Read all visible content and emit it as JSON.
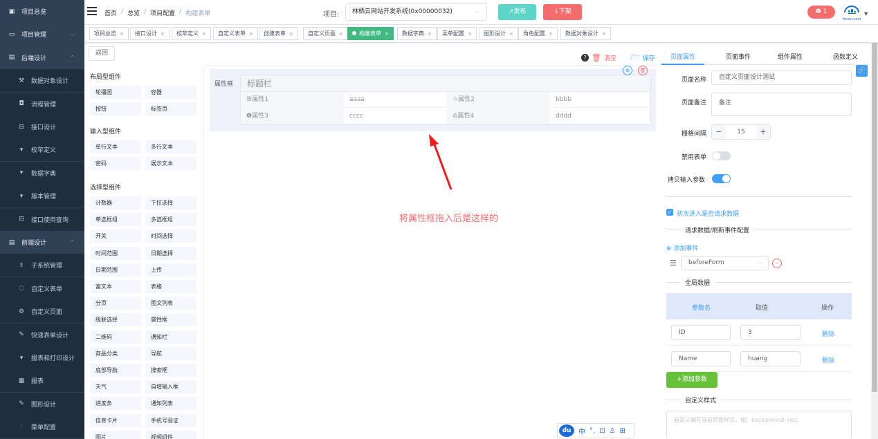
{
  "sidebar": {
    "items": [
      {
        "label": "项目总览",
        "icon": "folder-icon",
        "type": "top",
        "chevron": ""
      },
      {
        "label": "项目管理",
        "icon": "monitor-icon",
        "type": "top",
        "chevron": "⌵"
      },
      {
        "label": "后端设计",
        "icon": "server-icon",
        "type": "top",
        "chevron": "⌃"
      },
      {
        "label": "数据对象设计",
        "icon": "wrench-icon",
        "type": "sub",
        "chevron": ""
      },
      {
        "label": "流程管理",
        "icon": "flow-icon",
        "type": "sub",
        "chevron": ""
      },
      {
        "label": "接口设计",
        "icon": "api-icon",
        "type": "sub",
        "chevron": ""
      },
      {
        "label": "校苹定义",
        "icon": "cup-icon",
        "type": "sub",
        "chevron": ""
      },
      {
        "label": "数据字典",
        "icon": "cup-icon",
        "type": "sub",
        "chevron": ""
      },
      {
        "label": "版本管理",
        "icon": "cup-icon",
        "type": "sub",
        "chevron": ""
      },
      {
        "label": "接口使用查询",
        "icon": "api-icon",
        "type": "sub",
        "chevron": ""
      },
      {
        "label": "前端设计",
        "icon": "server-icon",
        "type": "top",
        "chevron": "⌃"
      },
      {
        "label": "子系统管理",
        "icon": "tree-icon",
        "type": "sub",
        "chevron": ""
      },
      {
        "label": "自定义表单",
        "icon": "chat-icon",
        "type": "sub",
        "chevron": ""
      },
      {
        "label": "自定义页面",
        "icon": "gear-icon",
        "type": "sub",
        "chevron": ""
      },
      {
        "label": "快速表单设计",
        "icon": "edit-icon",
        "type": "sub",
        "chevron": ""
      },
      {
        "label": "报表和打印设计",
        "icon": "cup-icon",
        "type": "sub",
        "chevron": ""
      },
      {
        "label": "报表",
        "icon": "report-icon",
        "type": "sub",
        "chevron": ""
      },
      {
        "label": "图形设计",
        "icon": "edit-icon",
        "type": "sub",
        "chevron": ""
      },
      {
        "label": "菜单配置",
        "icon": "menu-icon",
        "type": "sub",
        "chevron": ""
      }
    ]
  },
  "header": {
    "breadcrumb": [
      "首页",
      "总览",
      "项目配置",
      "构建表单"
    ],
    "project_label": "项目:",
    "project_value": "林栖云网站开发系统(0x00000032)",
    "publish_label": "↗发布",
    "takedown_label": "↓下架",
    "notification_count": "1",
    "logo_text": "Yecon.com"
  },
  "tags": [
    {
      "label": "项目总览",
      "active": false
    },
    {
      "label": "接口设计",
      "active": false
    },
    {
      "label": "校苹定义",
      "active": false
    },
    {
      "label": "自定义表单",
      "active": false
    },
    {
      "label": "创建表单",
      "active": false
    },
    {
      "label": "自定义页面",
      "active": false
    },
    {
      "label": "构建表单",
      "active": true
    },
    {
      "label": "数据字典",
      "active": false
    },
    {
      "label": "菜单配置",
      "active": false
    },
    {
      "label": "图形设计",
      "active": false
    },
    {
      "label": "角色配置",
      "active": false
    },
    {
      "label": "数据对象设计",
      "active": false
    }
  ],
  "main": {
    "back_label": "返回",
    "clear_label": "清空",
    "save_label": "保存",
    "note": "将属性框拖入后是这样的"
  },
  "palette": {
    "groups": [
      {
        "title": "布局型组件",
        "items": [
          "轮播图",
          "容器",
          "按钮",
          "标签页"
        ]
      },
      {
        "title": "输入型组件",
        "items": [
          "单行文本",
          "多行文本",
          "密码",
          "展示文本"
        ]
      },
      {
        "title": "选择型组件",
        "items": [
          "计数器",
          "下拉选择",
          "单选框组",
          "多选框组",
          "开关",
          "时间选择",
          "时间范围",
          "日期选择",
          "日期范围",
          "上传",
          "富文本",
          "表格",
          "分页",
          "图文列表",
          "级联选择",
          "属性框",
          "二维码",
          "通知栏",
          "商品分类",
          "导航",
          "底部导航",
          "搜索框",
          "天气",
          "自增输入框",
          "进度条",
          "通知列表",
          "信息卡片",
          "手机号验证",
          "图片",
          "视频组件"
        ]
      }
    ]
  },
  "prop_frame": {
    "label": "属性框",
    "title": "标题栏",
    "rows": [
      [
        {
          "label": "ꕥ属性1",
          "value": "aaaa"
        },
        {
          "label": "☆属性2",
          "value": "bbbb"
        }
      ],
      [
        {
          "label": "❶属性3",
          "value": "cccc"
        },
        {
          "label": "⊘属性4",
          "value": "dddd"
        }
      ]
    ]
  },
  "ime": {
    "logo": "du",
    "items": [
      "中",
      "°,",
      "⊡",
      "♙",
      "⊞"
    ]
  },
  "right_panel": {
    "tabs": [
      "页面属性",
      "页面事件",
      "组件属性",
      "函数定义"
    ],
    "page_name_label": "页面名称",
    "page_name_value": "自定义页面设计测试",
    "page_note_label": "页面备注",
    "page_note_value": "备注",
    "grid_gap_label": "栅格间隔",
    "grid_gap_value": "15",
    "disable_form_label": "禁用表单",
    "copy_params_label": "拷贝输入参数",
    "disable_form_on": false,
    "copy_params_on": true,
    "first_request_label": "初次进入是否请求数据",
    "request_config_title": "请求数据/刷新事件配置",
    "add_event_label": "添加事件",
    "event_value": "beforeForm",
    "global_data_title": "全局数据",
    "table_headers": [
      "参数名",
      "取值",
      "操作"
    ],
    "table_rows": [
      {
        "name": "ID",
        "value": "3",
        "action": "删除"
      },
      {
        "name": "Name",
        "value": "huang",
        "action": "删除"
      }
    ],
    "add_param_label": "+添加参数",
    "custom_style_title": "自定义样式",
    "custom_style_placeholder": "自定义编写当前页面样式，如：background: red;"
  },
  "colors": {
    "sidebar": "#304156",
    "accent": "#409eff",
    "active_tag": "#42b983",
    "danger": "#f56c6c",
    "publish": "#5dd5c8"
  }
}
